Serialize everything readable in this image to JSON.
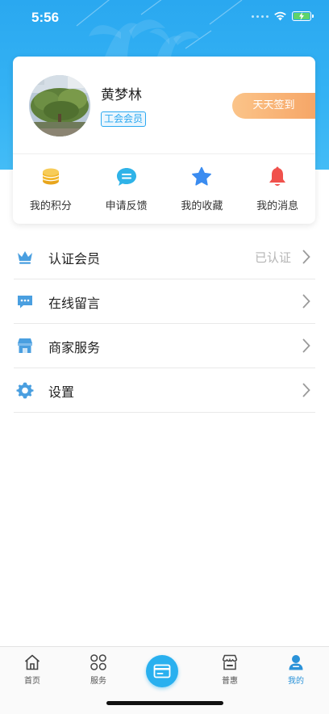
{
  "status_bar": {
    "time": "5:56"
  },
  "profile": {
    "name": "黄梦林",
    "badge": "工会会员",
    "signin_label": "天天签到"
  },
  "quick_actions": [
    {
      "label": "我的积分",
      "icon": "coins-icon",
      "color": "#f2b72c"
    },
    {
      "label": "申请反馈",
      "icon": "chat-bubble-icon",
      "color": "#2fb3e8"
    },
    {
      "label": "我的收藏",
      "icon": "star-icon",
      "color": "#3b8cf0"
    },
    {
      "label": "我的消息",
      "icon": "bell-icon",
      "color": "#f0514c"
    }
  ],
  "menu": [
    {
      "label": "认证会员",
      "value": "已认证",
      "icon": "crown-icon"
    },
    {
      "label": "在线留言",
      "value": "",
      "icon": "message-icon"
    },
    {
      "label": "商家服务",
      "value": "",
      "icon": "store-icon"
    },
    {
      "label": "设置",
      "value": "",
      "icon": "gear-icon"
    }
  ],
  "tabs": [
    {
      "label": "首页",
      "icon": "home-icon"
    },
    {
      "label": "服务",
      "icon": "grid-icon"
    },
    {
      "label": "",
      "icon": "card-icon"
    },
    {
      "label": "普惠",
      "icon": "shop-icon"
    },
    {
      "label": "我的",
      "icon": "user-icon",
      "active": true
    }
  ],
  "colors": {
    "primary": "#2aa8f0",
    "signin_gradient_start": "#fbc489",
    "signin_gradient_end": "#f6a667",
    "active_tab": "#2a92d8"
  }
}
